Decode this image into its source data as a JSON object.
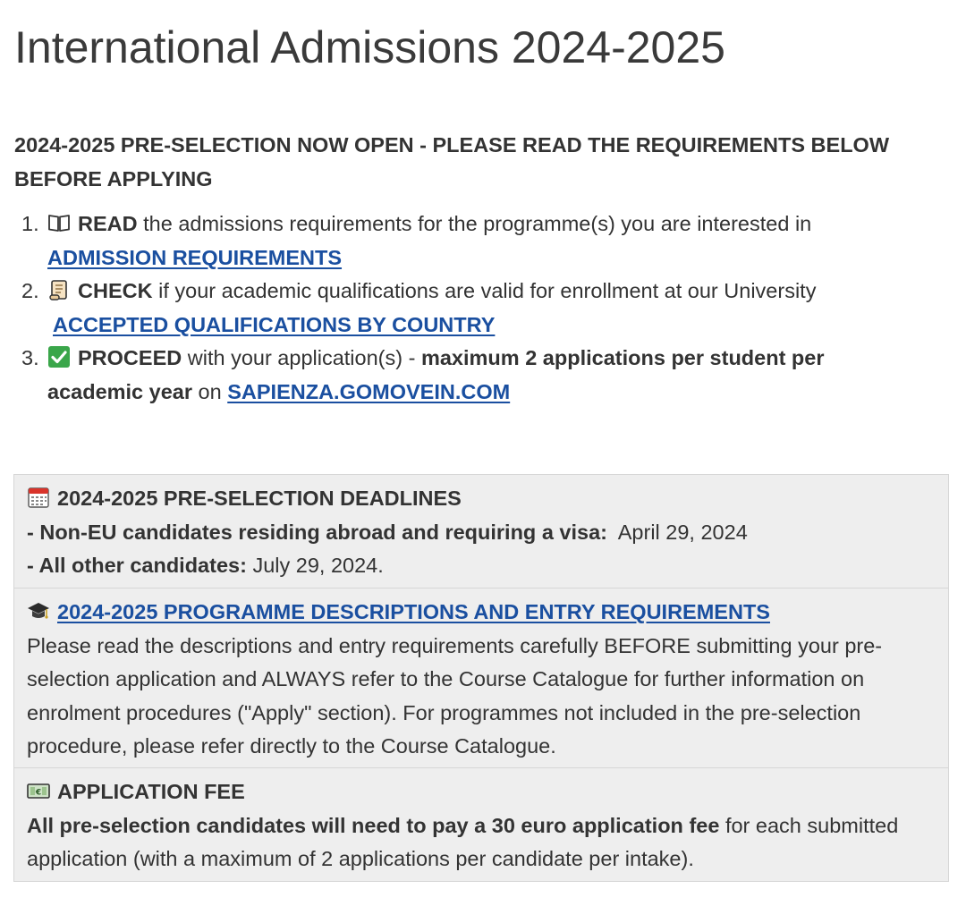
{
  "page": {
    "title": "International Admissions 2024-2025",
    "notice": "2024-2025 PRE-SELECTION NOW OPEN - PLEASE READ THE REQUIREMENTS BELOW BEFORE APPLYING"
  },
  "steps": [
    {
      "number": "1.",
      "icon": "open-book-icon",
      "keyword": "READ",
      "text": " the admissions requirements for the programme(s) you are interested in",
      "link": "ADMISSION REQUIREMENTS"
    },
    {
      "number": "2.",
      "icon": "scroll-icon",
      "keyword": "CHECK",
      "text": " if your academic qualifications are valid for enrollment at our University",
      "link": "ACCEPTED QUALIFICATIONS BY COUNTRY"
    },
    {
      "number": "3.",
      "icon": "check-mark-button-icon",
      "keyword": "PROCEED",
      "text_a": " with your application(s) - ",
      "bold_text": "maximum 2 applications per student per academic year",
      "text_b": " on ",
      "link": "SAPIENZA.GOMOVEIN.COM"
    }
  ],
  "deadlines": {
    "icon": "calendar-icon",
    "heading": "2024-2025 PRE-SELECTION DEADLINES",
    "items": [
      {
        "label": "- Non-EU candidates residing abroad and requiring a visa:",
        "value": "  April 29, 2024"
      },
      {
        "label": "- All other candidates:",
        "value": " July 29, 2024."
      }
    ]
  },
  "programmes": {
    "icon": "graduation-cap-icon",
    "link": "2024-2025 PROGRAMME DESCRIPTIONS AND ENTRY REQUIREMENTS",
    "text": "Please read the descriptions and entry requirements carefully BEFORE submitting your pre-selection application and ALWAYS refer to the Course Catalogue for further information on enrolment procedures (\"Apply\" section). For programmes not included in the pre-selection procedure, please refer directly to the Course Catalogue."
  },
  "fee": {
    "icon": "euro-banknote-icon",
    "heading": "APPLICATION FEE",
    "bold_text": "All pre-selection candidates will need to pay a 30 euro application fee",
    "text": " for each submitted application (with a maximum of 2 applications per candidate per intake)."
  },
  "colors": {
    "link": "#1a4fa0",
    "text": "#333333",
    "box_background": "#eeeeee",
    "box_border": "#d6d6d6"
  }
}
